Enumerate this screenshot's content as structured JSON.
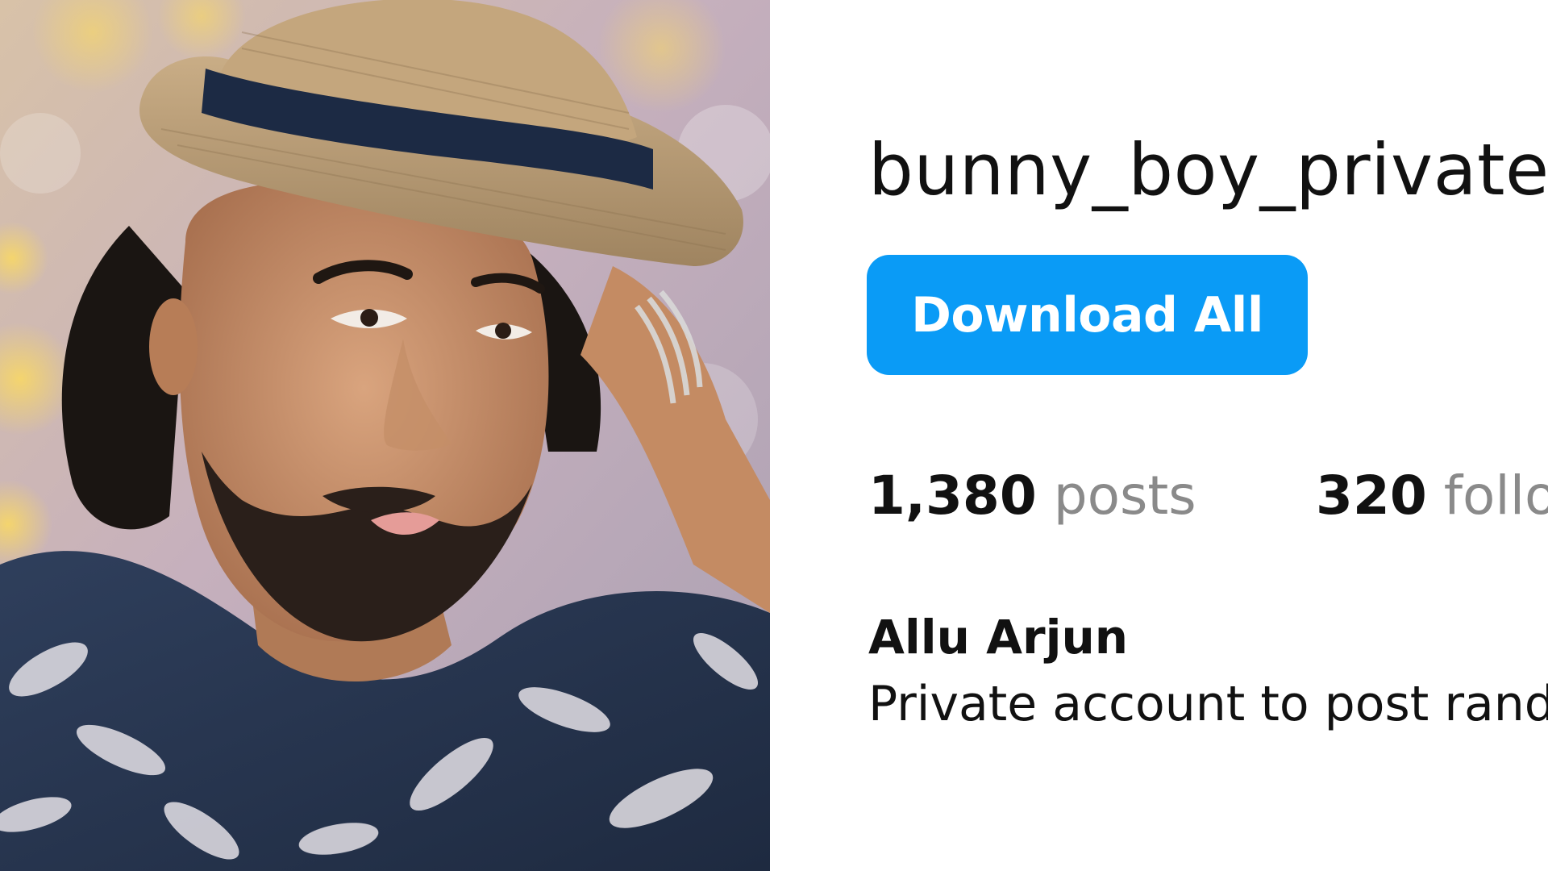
{
  "profile": {
    "username": "bunny_boy_private",
    "download_button_label": "Download All",
    "stats": {
      "posts_count": "1,380",
      "posts_label": "posts",
      "followers_count": "320",
      "followers_label": "follo"
    },
    "full_name": "Allu Arjun",
    "bio": "Private account to post rando"
  },
  "colors": {
    "button_background": "#0a9bf6",
    "button_text": "#ffffff",
    "primary_text": "#111111",
    "secondary_text": "#8a8a8a",
    "background": "#ffffff"
  },
  "icons": {
    "profile_photo": "profile-photo"
  }
}
